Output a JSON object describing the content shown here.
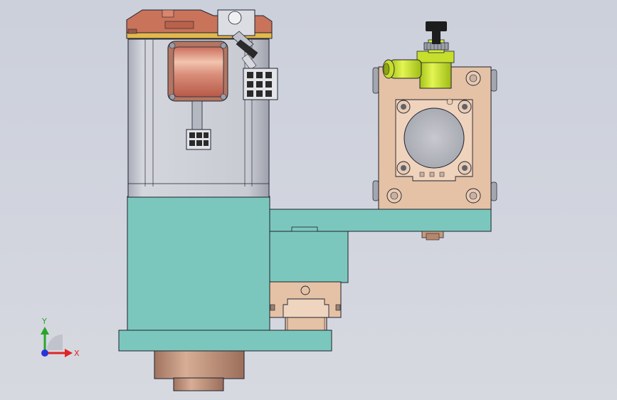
{
  "view": {
    "background_top": "#ccd0db",
    "background_bottom": "#d7d9e0"
  },
  "colors": {
    "motor_body": "#c9cbd2",
    "motor_cap": "#c8735a",
    "motor_band": "#e1b84d",
    "bracket_teal": "#7cc7bd",
    "cylinder_plate": "#e5c2a5",
    "fitting_green": "#d3ec3a",
    "knob_black": "#1d1d1d",
    "bronze_hub": "#c79a7e",
    "outline": "#1e2230"
  },
  "triad": {
    "y_label": "Y",
    "x_label": "X",
    "y_color": "#2aa52a",
    "x_color": "#e02424",
    "z_color": "#2a35d8",
    "icon": "axis-triad-icon"
  }
}
